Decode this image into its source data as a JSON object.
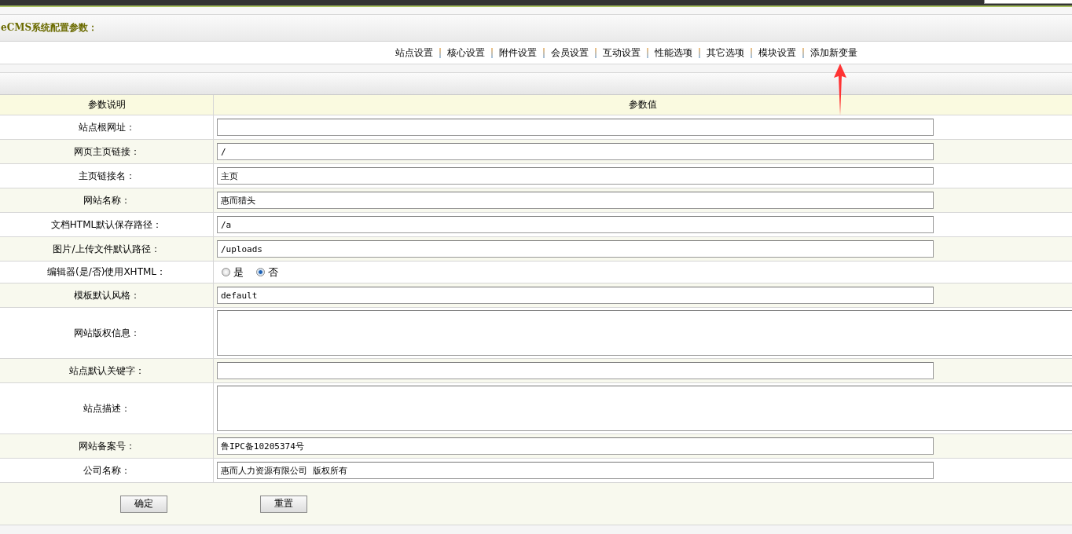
{
  "header": {
    "title": "eCMS系统配置参数："
  },
  "nav": [
    {
      "label": "站点设置"
    },
    {
      "label": "核心设置"
    },
    {
      "label": "附件设置"
    },
    {
      "label": "会员设置"
    },
    {
      "label": "互动设置"
    },
    {
      "label": "性能选项"
    },
    {
      "label": "其它选项"
    },
    {
      "label": "模块设置"
    },
    {
      "label": "添加新变量"
    }
  ],
  "table": {
    "columns": [
      "参数说明",
      "参数值"
    ],
    "rows": [
      {
        "label": "站点根网址：",
        "kind": "text",
        "value": ""
      },
      {
        "label": "网页主页链接：",
        "kind": "text",
        "value": "/"
      },
      {
        "label": "主页链接名：",
        "kind": "text",
        "value": "主页"
      },
      {
        "label": "网站名称：",
        "kind": "text",
        "value": "惠而猎头"
      },
      {
        "label": "文档HTML默认保存路径：",
        "kind": "text",
        "value": "/a"
      },
      {
        "label": "图片/上传文件默认路径：",
        "kind": "text",
        "value": "/uploads"
      },
      {
        "label": "编辑器(是/否)使用XHTML：",
        "kind": "radio",
        "options": [
          {
            "label": "是",
            "selected": false
          },
          {
            "label": "否",
            "selected": true
          }
        ]
      },
      {
        "label": "模板默认风格：",
        "kind": "text",
        "value": "default"
      },
      {
        "label": "网站版权信息：",
        "kind": "textarea",
        "value": ""
      },
      {
        "label": "站点默认关键字：",
        "kind": "text",
        "value": ""
      },
      {
        "label": "站点描述：",
        "kind": "textarea",
        "value": ""
      },
      {
        "label": "网站备案号：",
        "kind": "text",
        "value": "鲁IPC备10205374号"
      },
      {
        "label": "公司名称：",
        "kind": "text",
        "value": "惠而人力资源有限公司 版权所有"
      }
    ]
  },
  "buttons": [
    {
      "label": "确定"
    },
    {
      "label": "重置"
    }
  ]
}
